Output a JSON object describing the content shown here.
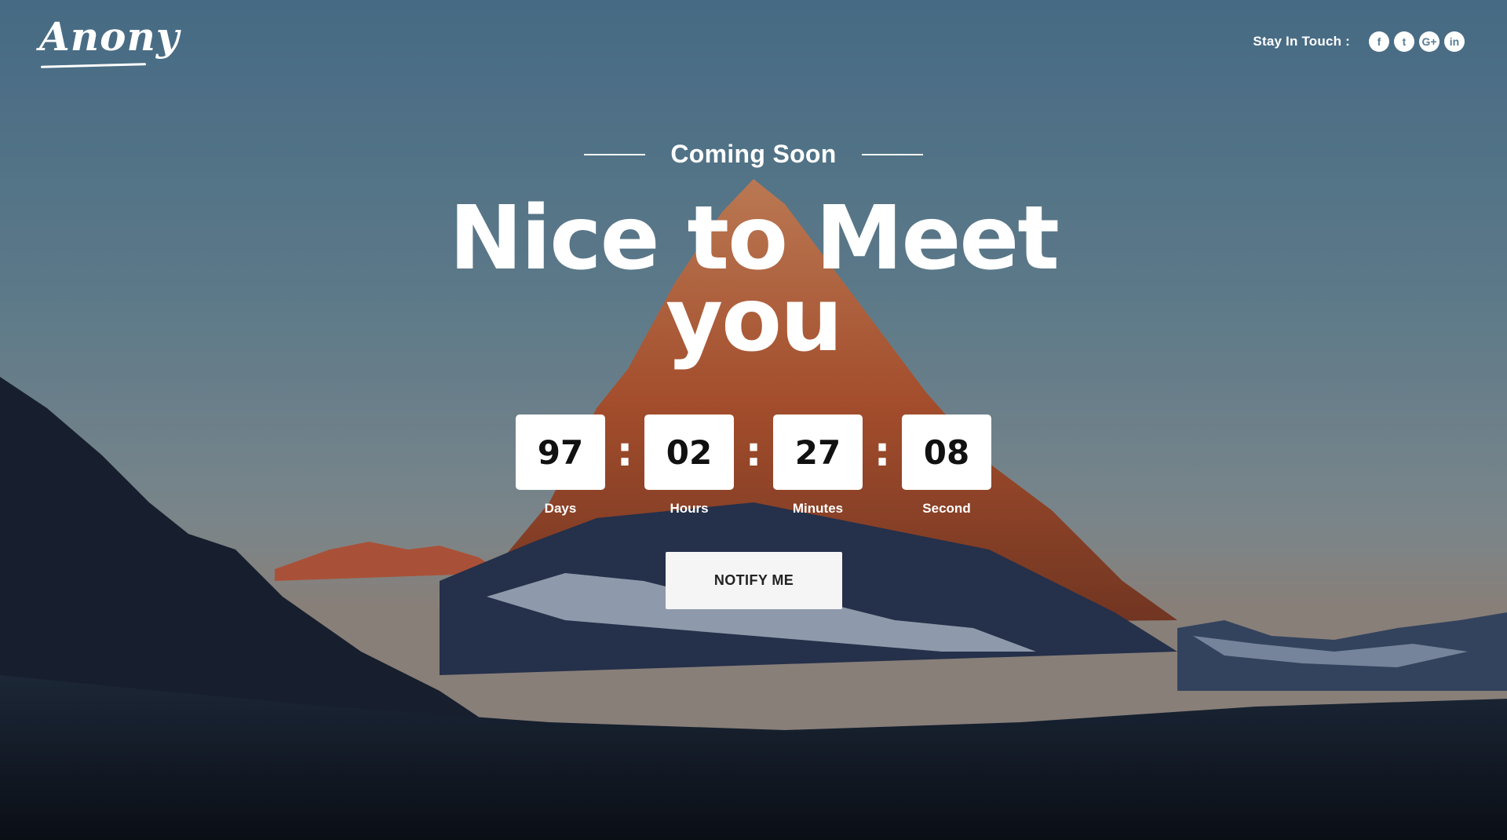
{
  "brand": {
    "logo_text": "Anony"
  },
  "header": {
    "social_label": "Stay In Touch :",
    "social_icons": [
      {
        "name": "facebook-icon",
        "glyph": "f"
      },
      {
        "name": "twitter-icon",
        "glyph": "t"
      },
      {
        "name": "google-plus-icon",
        "glyph": "G+"
      },
      {
        "name": "linkedin-icon",
        "glyph": "in"
      }
    ]
  },
  "hero": {
    "kicker": "Coming Soon",
    "headline_line1": "Nice to Meet",
    "headline_line2": "you"
  },
  "countdown": {
    "days": "97",
    "hours": "02",
    "minutes": "27",
    "seconds": "08",
    "separator": ":",
    "labels": {
      "days": "Days",
      "hours": "Hours",
      "minutes": "Minutes",
      "seconds": "Second"
    }
  },
  "cta": {
    "notify_label": "NOTIFY ME"
  },
  "colors": {
    "sky_top": "#4e7690",
    "peak_orange": "#c9663a",
    "box_bg": "#ffffff",
    "button_bg": "#f5f5f5"
  }
}
